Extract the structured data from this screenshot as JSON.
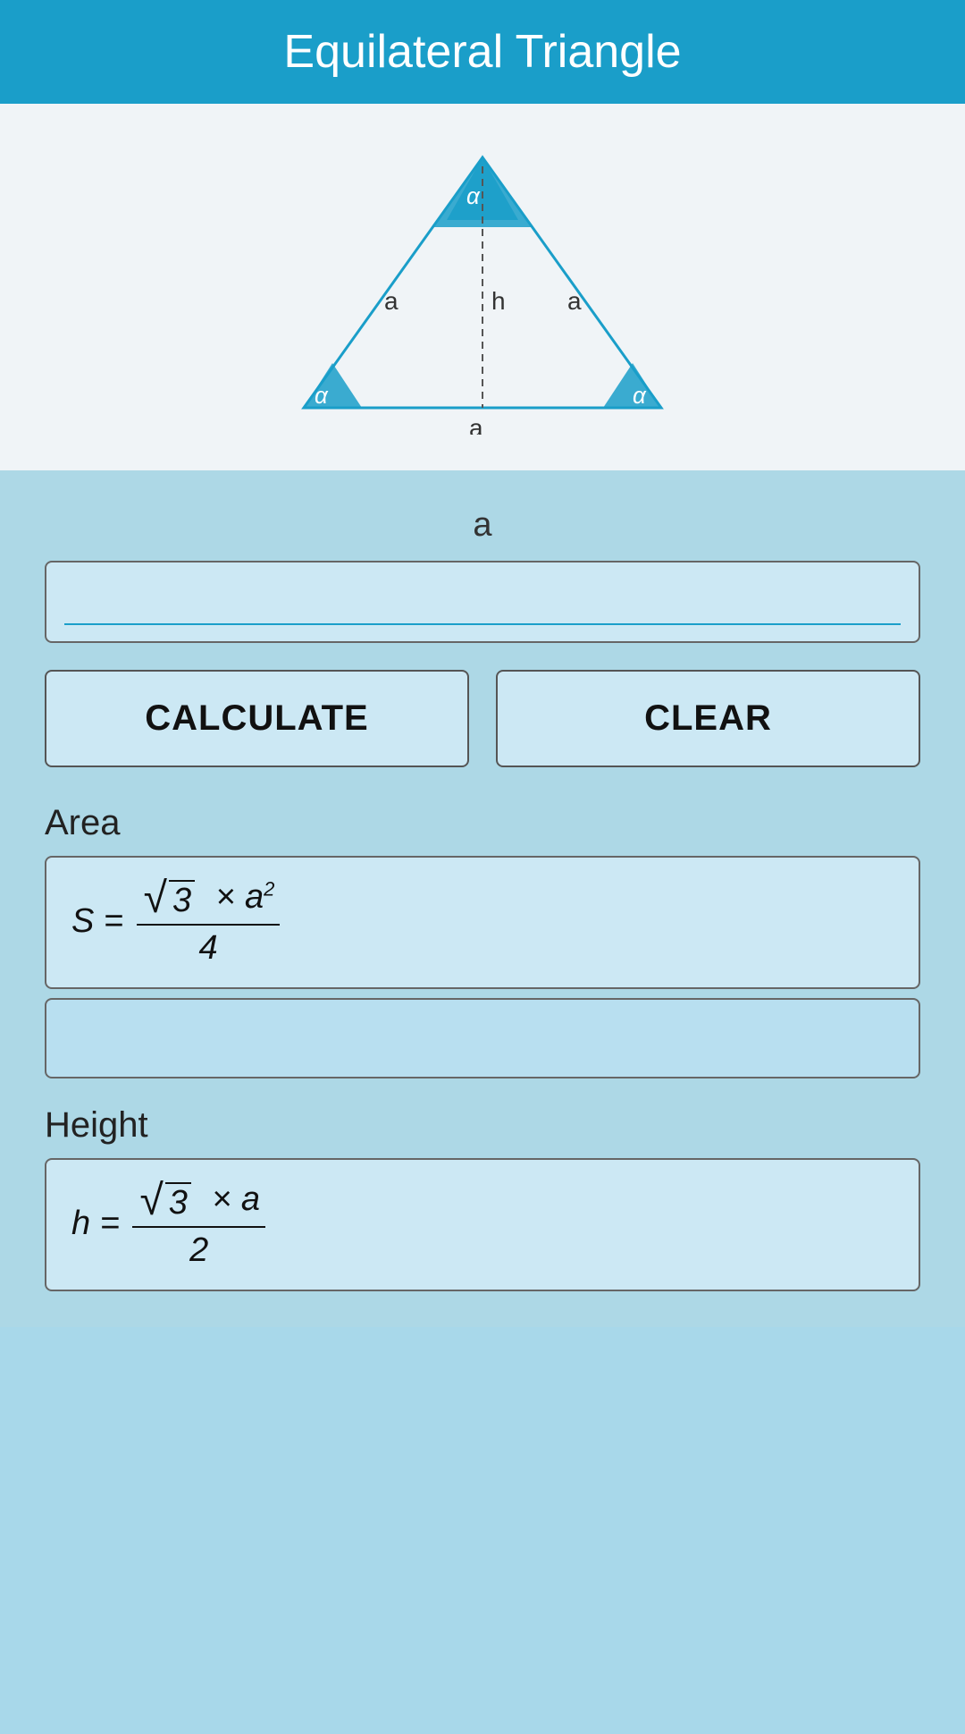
{
  "header": {
    "title": "Equilateral Triangle"
  },
  "diagram": {
    "side_label": "a",
    "height_label": "h",
    "angle_label": "α"
  },
  "calculator": {
    "input_label": "a",
    "input_placeholder": "",
    "calculate_button": "CALCULATE",
    "clear_button": "CLEAR",
    "area_section": {
      "label": "Area",
      "formula_display": "S = (√3 × a²) / 4",
      "result": ""
    },
    "height_section": {
      "label": "Height",
      "formula_display": "h = (√3 × a) / 2",
      "result": ""
    }
  }
}
